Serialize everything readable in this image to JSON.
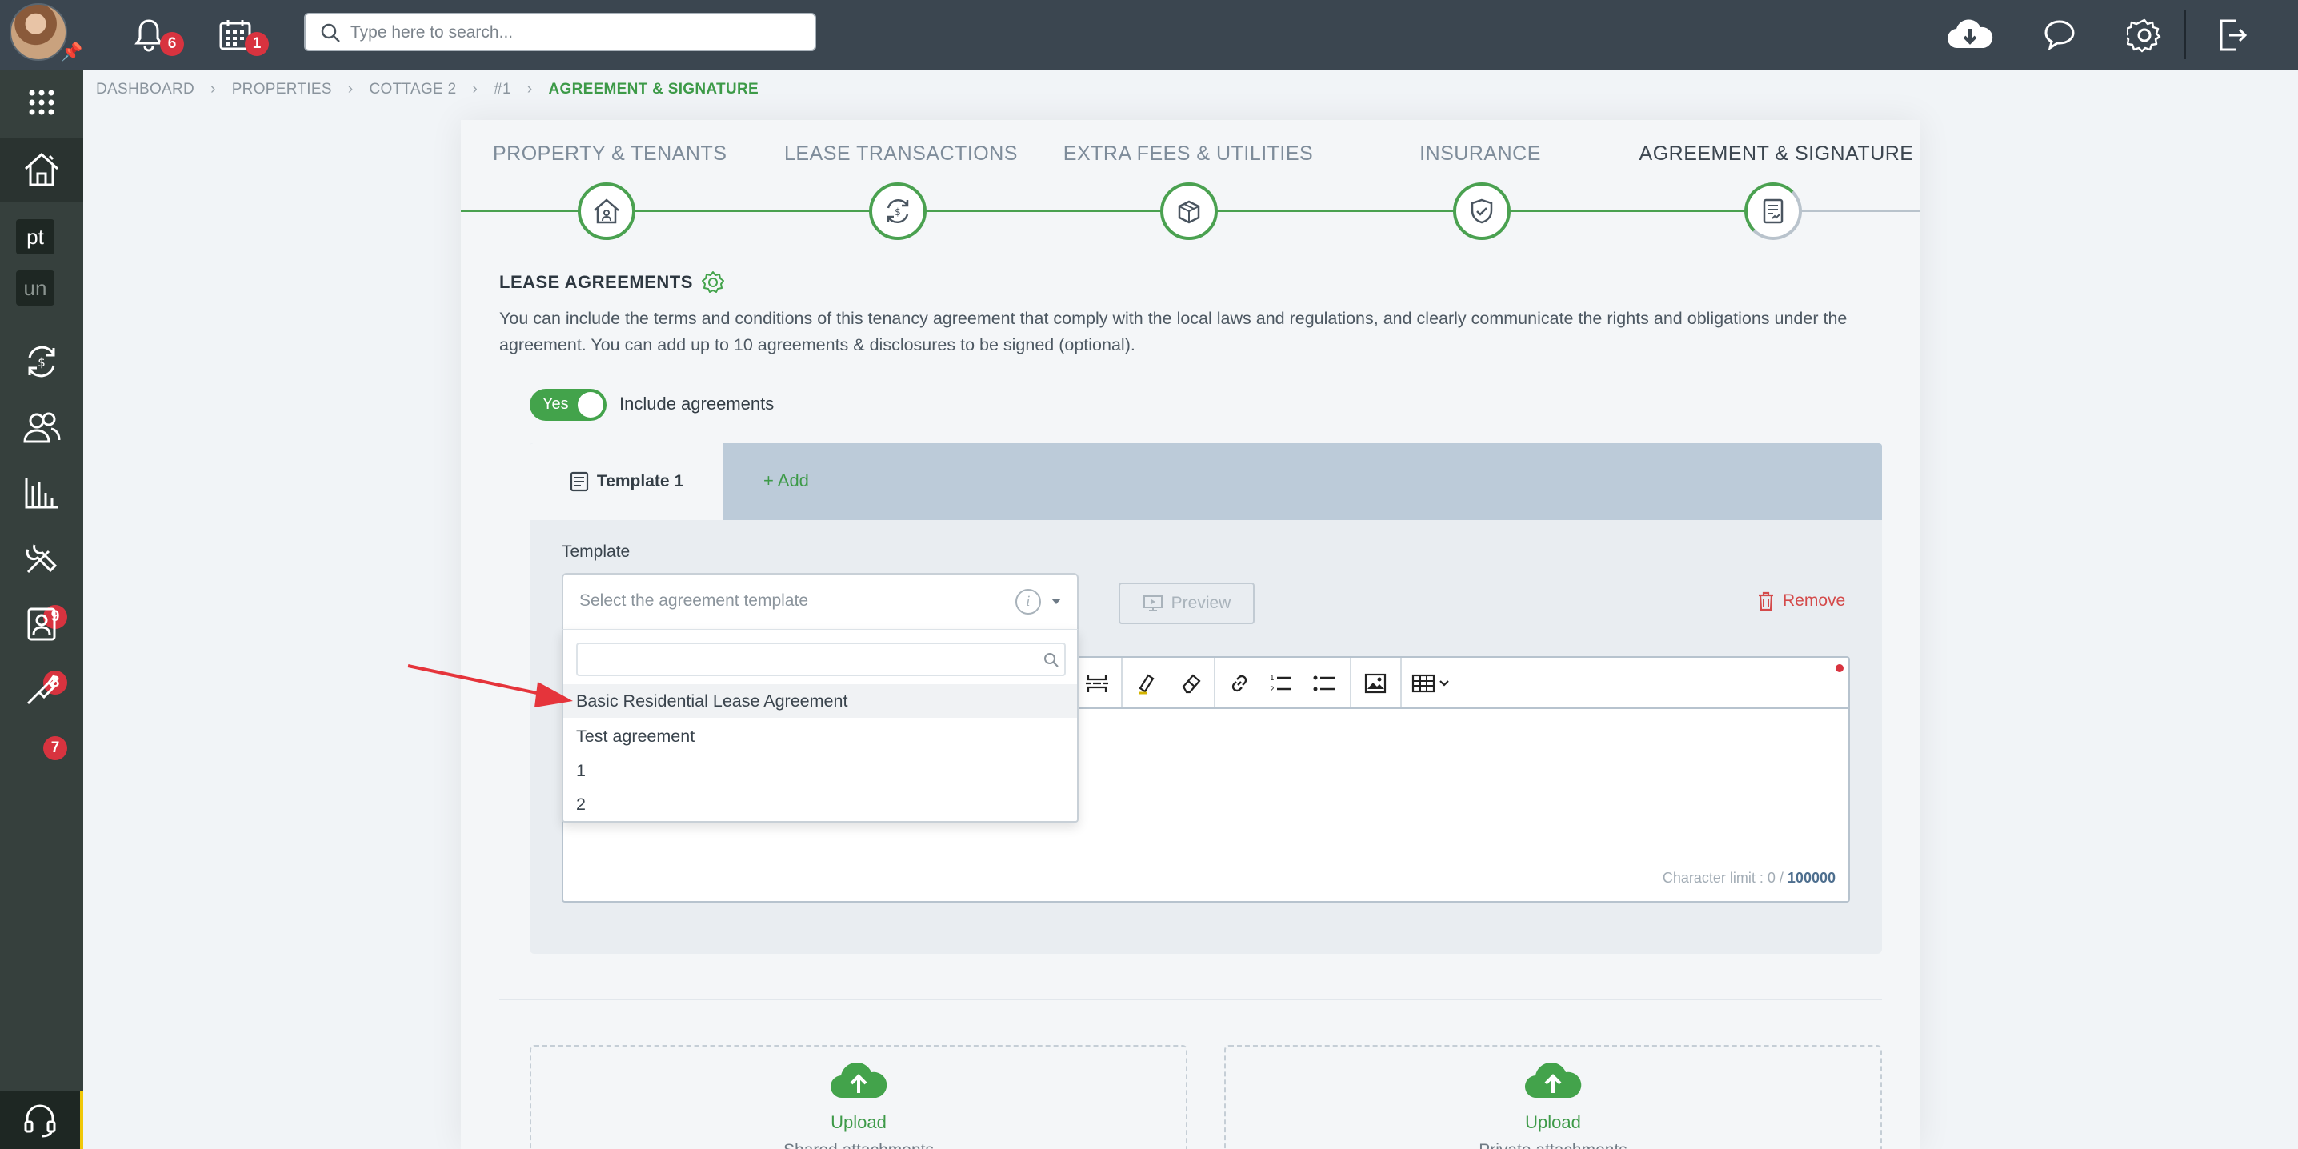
{
  "topbar": {
    "notifications_count": "6",
    "calendar_count": "1",
    "search_placeholder": "Type here to search..."
  },
  "sidebar": {
    "items": [
      {
        "icon": "apps-grid-icon"
      },
      {
        "icon": "properties-house-icon"
      },
      {
        "text": "pt"
      },
      {
        "text": "un"
      },
      {
        "icon": "transactions-icon"
      },
      {
        "icon": "people-icon"
      },
      {
        "icon": "reports-chart-icon"
      },
      {
        "icon": "maintenance-tools-icon",
        "badge": "9"
      },
      {
        "icon": "applicants-icon",
        "badge": "8"
      },
      {
        "icon": "tools-icon",
        "badge": "7"
      }
    ]
  },
  "breadcrumb": [
    "DASHBOARD",
    "PROPERTIES",
    "COTTAGE 2",
    "#1",
    "AGREEMENT & SIGNATURE"
  ],
  "steps": [
    {
      "label": "PROPERTY & TENANTS",
      "icon": "property-tenants-icon"
    },
    {
      "label": "LEASE TRANSACTIONS",
      "icon": "lease-transactions-icon"
    },
    {
      "label": "EXTRA FEES & UTILITIES",
      "icon": "extra-fees-icon"
    },
    {
      "label": "INSURANCE",
      "icon": "insurance-shield-icon"
    },
    {
      "label": "AGREEMENT & SIGNATURE",
      "icon": "agreement-signature-icon"
    }
  ],
  "lease_agreements": {
    "title": "LEASE AGREEMENTS",
    "description": "You can include the terms and conditions of this tenancy agreement that comply with the local laws and regulations, and clearly communicate the rights and obligations under the agreement. You can add up to 10 agreements & disclosures to be signed (optional).",
    "toggle_state": "Yes",
    "toggle_label": "Include agreements"
  },
  "template_tabs": {
    "active": "Template 1",
    "add": "Add"
  },
  "template_form": {
    "label": "Template",
    "placeholder": "Select the agreement template",
    "info": "i",
    "preview": "Preview",
    "remove": "Remove",
    "options": [
      "Basic Residential Lease Agreement",
      "Test agreement",
      "1",
      "2"
    ],
    "highlighted_option": "Basic Residential Lease Agreement"
  },
  "editor": {
    "char_limit_label": "Character limit : 0 / ",
    "char_limit_max": "100000"
  },
  "uploads": [
    {
      "label": "Upload",
      "sub": "Shared attachments"
    },
    {
      "label": "Upload",
      "sub": "Private attachments"
    }
  ],
  "colors": {
    "accent_green": "#43a34b",
    "topbar": "#3b4650",
    "sidebar": "#36403d",
    "badge_red": "#d8333f",
    "arrow_red": "#e5343b"
  }
}
